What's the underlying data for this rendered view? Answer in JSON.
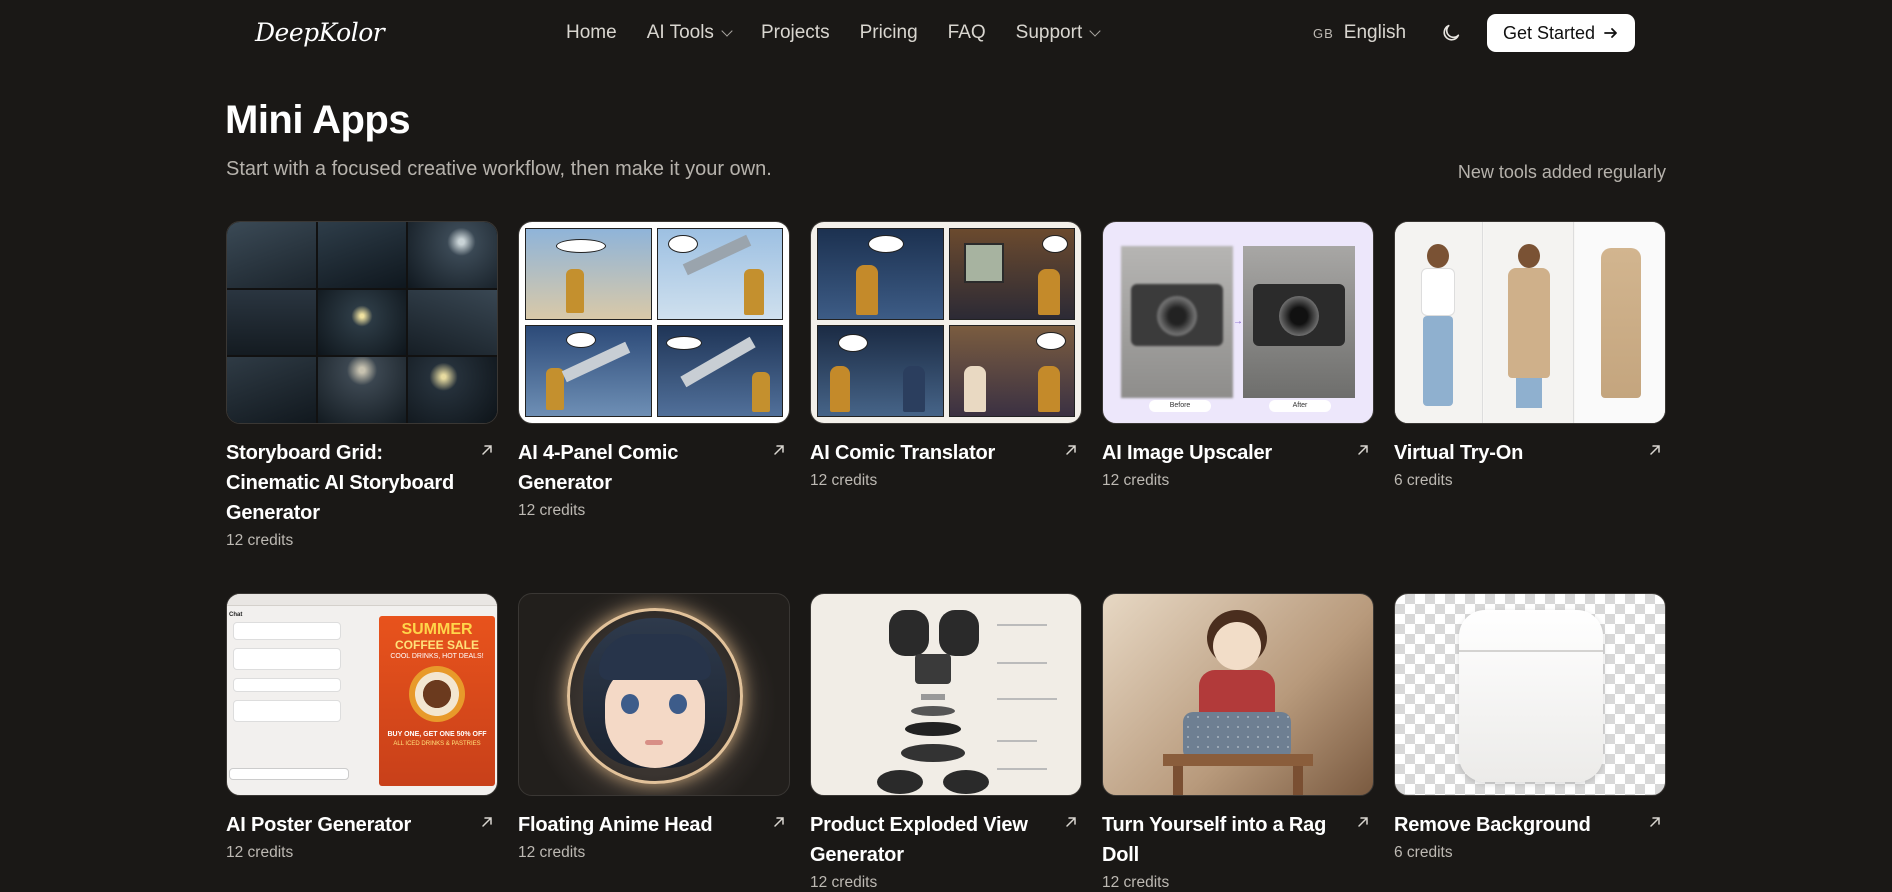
{
  "nav": {
    "logo": "DeepKolor",
    "links": [
      {
        "label": "Home"
      },
      {
        "label": "AI Tools",
        "dropdown": true
      },
      {
        "label": "Projects"
      },
      {
        "label": "Pricing"
      },
      {
        "label": "FAQ"
      },
      {
        "label": "Support",
        "dropdown": true
      }
    ],
    "lang_flag": "GB",
    "lang_label": "English",
    "theme_icon": "moon-icon",
    "cta_label": "Get Started"
  },
  "header": {
    "title": "Mini Apps",
    "subtitle": "Start with a focused creative workflow, then make it your own.",
    "note": "New tools added regularly"
  },
  "cards": [
    {
      "title": "Storyboard Grid: Cinematic AI Storyboard Generator",
      "credits": "12 credits"
    },
    {
      "title": "AI 4-Panel Comic Generator",
      "credits": "12 credits"
    },
    {
      "title": "AI Comic Translator",
      "credits": "12 credits"
    },
    {
      "title": "AI Image Upscaler",
      "credits": "12 credits",
      "before": "Before",
      "after": "After"
    },
    {
      "title": "Virtual Try-On",
      "credits": "6 credits"
    },
    {
      "title": "AI Poster Generator",
      "credits": "12 credits",
      "poster_headline": "SUMMER",
      "poster_line2": "COFFEE SALE",
      "poster_tag": "COOL DRINKS, HOT DEALS!",
      "poster_offer": "BUY ONE, GET ONE 50% OFF",
      "poster_sub": "ALL ICED DRINKS & PASTRIES",
      "chat_title": "Chat"
    },
    {
      "title": "Floating Anime Head",
      "credits": "12 credits"
    },
    {
      "title": "Product Exploded View Generator",
      "credits": "12 credits"
    },
    {
      "title": "Turn Yourself into a Rag Doll",
      "credits": "12 credits"
    },
    {
      "title": "Remove Background",
      "credits": "6 credits"
    }
  ],
  "colors": {
    "background": "#1a1816",
    "text": "#f2f0ec",
    "muted": "#b6b2ac",
    "cta_bg": "#ffffff"
  }
}
